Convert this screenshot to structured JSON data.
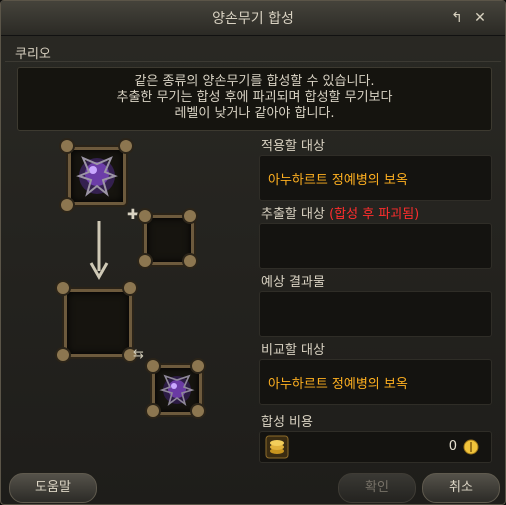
{
  "window": {
    "title": "양손무기 합성",
    "subtitle": "쿠리오"
  },
  "notice": {
    "line1": "같은 종류의 양손무기를 합성할 수 있습니다.",
    "line2": "추출한 무기는 합성 후에 파괴되며 합성할 무기보다",
    "line3": "레벨이 낮거나 같아야 합니다."
  },
  "fields": {
    "apply_label": "적용할 대상",
    "apply_value": "아누하르트 정예병의 보옥",
    "extract_label": "추출할 대상",
    "extract_warning": "(합성 후 파괴됨)",
    "extract_value": "",
    "result_label": "예상 결과물",
    "result_value": "",
    "compare_label": "비교할 대상",
    "compare_value": "아누하르트 정예병의 보옥",
    "cost_label": "합성 비용",
    "cost_value": "0"
  },
  "buttons": {
    "help": "도움말",
    "confirm": "확인",
    "cancel": "취소"
  },
  "colors": {
    "item_name": "#ffb020",
    "warning": "#ff2d2d"
  }
}
